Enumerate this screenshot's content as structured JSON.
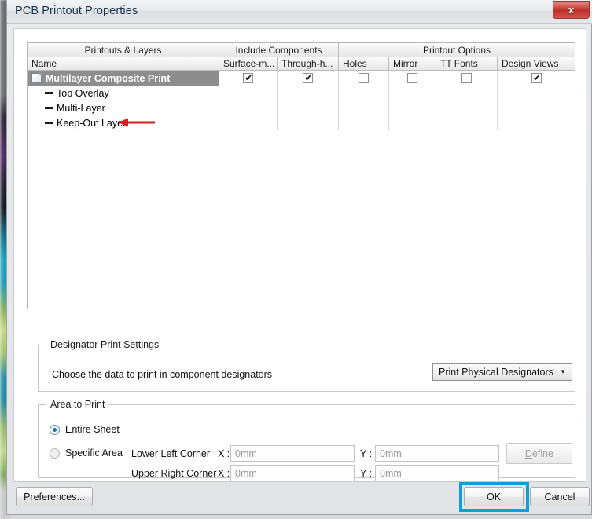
{
  "window": {
    "title": "PCB Printout Properties",
    "close_label": "x"
  },
  "table": {
    "group_headers": [
      {
        "label": "Printouts & Layers"
      },
      {
        "label": "Include Components"
      },
      {
        "label": "Printout Options"
      }
    ],
    "columns": [
      {
        "label": "Name"
      },
      {
        "label": "Surface-m..."
      },
      {
        "label": "Through-h..."
      },
      {
        "label": "Holes"
      },
      {
        "label": "Mirror"
      },
      {
        "label": "TT Fonts"
      },
      {
        "label": "Design Views"
      }
    ],
    "rows": [
      {
        "name": "Multilayer Composite Print",
        "type": "printout",
        "selected": true,
        "surface_mount": true,
        "through_hole": true,
        "holes": false,
        "mirror": false,
        "tt_fonts": false,
        "design_views": true
      },
      {
        "name": "Top Overlay",
        "type": "layer",
        "selected": false,
        "annotated": true
      },
      {
        "name": "Multi-Layer",
        "type": "layer",
        "selected": false,
        "annotated": false
      },
      {
        "name": "Keep-Out Layer",
        "type": "layer",
        "selected": false,
        "annotated": false
      }
    ]
  },
  "designator_settings": {
    "group_title": "Designator Print Settings",
    "label": "Choose the data to print in component designators",
    "select_value": "Print Physical Designators",
    "caret": "▾"
  },
  "area_to_print": {
    "group_title": "Area to Print",
    "entire_sheet_label": "Entire Sheet",
    "specific_area_label": "Specific Area",
    "selected": "Entire Sheet",
    "lower_left_label": "Lower Left Corner",
    "upper_right_label": "Upper Right Corner",
    "x_label": "X :",
    "y_label": "Y :",
    "lower_left_x": "0mm",
    "lower_left_y": "0mm",
    "upper_right_x": "0mm",
    "upper_right_y": "0mm",
    "define_label_prefix": "",
    "define_label_accel": "D",
    "define_label_rest": "efine"
  },
  "footer": {
    "preferences_label": "Preferences...",
    "ok_label": "OK",
    "cancel_label": "Cancel"
  },
  "annotations": {
    "highlight_color": "#0e9ede",
    "arrow_color": "#d41f1f"
  }
}
